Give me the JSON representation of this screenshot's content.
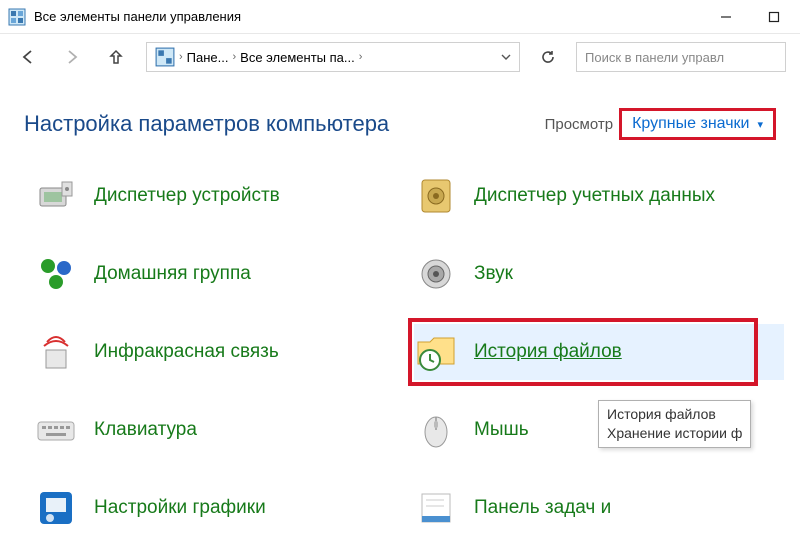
{
  "window": {
    "title": "Все элементы панели управления"
  },
  "breadcrumbs": {
    "seg1": "Пане...",
    "seg2": "Все элементы па..."
  },
  "search": {
    "placeholder": "Поиск в панели управл"
  },
  "header": {
    "title": "Настройка параметров компьютера",
    "view_label": "Просмотр",
    "view_value": "Крупные значки"
  },
  "items": {
    "device_manager": "Диспетчер устройств",
    "credential_manager": "Диспетчер учетных данных",
    "homegroup": "Домашняя группа",
    "sound": "Звук",
    "infrared": "Инфракрасная связь",
    "file_history": "История файлов",
    "keyboard": "Клавиатура",
    "mouse": "Мышь",
    "graphics": "Настройки графики",
    "taskbar": "Панель задач и"
  },
  "tooltip": {
    "line1": "История файлов",
    "line2": "Хранение истории ф"
  }
}
